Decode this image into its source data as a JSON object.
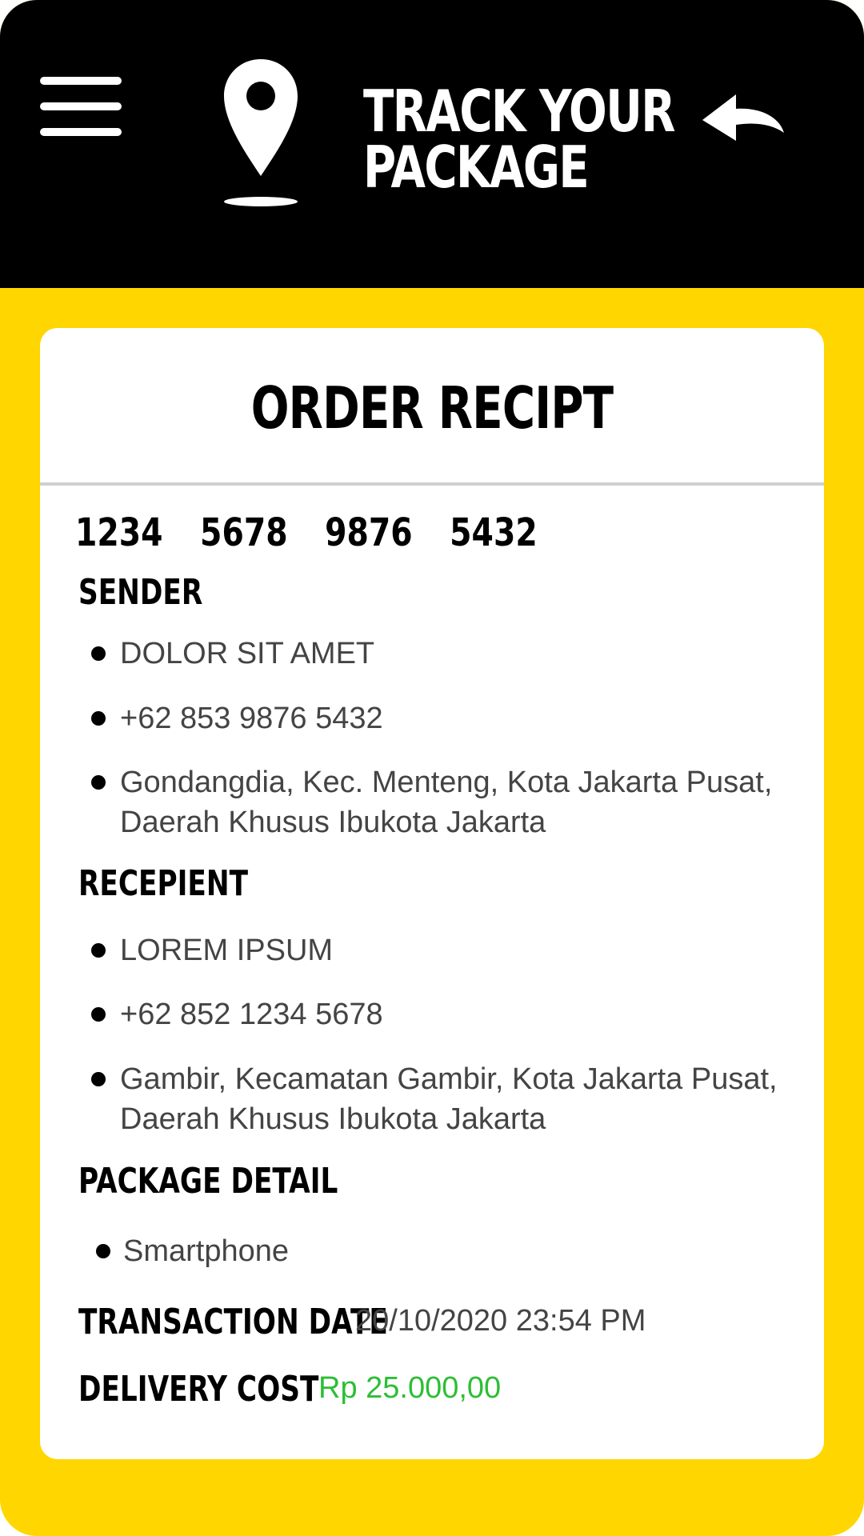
{
  "header": {
    "title_line1": "TRACK YOUR",
    "title_line2": "PACKAGE",
    "menu_icon": "hamburger-menu-icon",
    "pin_icon": "location-pin-icon",
    "back_icon": "back-arrow-icon"
  },
  "receipt": {
    "title": "ORDER RECIPT",
    "tracking_number": [
      "1234",
      "5678",
      "9876",
      "5432"
    ],
    "sender": {
      "label": "SENDER",
      "name": "DOLOR SIT AMET",
      "phone": "+62 853 9876 5432",
      "address_line1": "Gondangdia, Kec. Menteng, Kota Jakarta Pusat,",
      "address_line2": "Daerah Khusus Ibukota Jakarta"
    },
    "recipient": {
      "label": "RECEPIENT",
      "name": "LOREM IPSUM",
      "phone": "+62 852 1234 5678",
      "address_line1": "Gambir, Kecamatan Gambir, Kota Jakarta Pusat,",
      "address_line2": "Daerah Khusus Ibukota Jakarta"
    },
    "package_detail": {
      "label": "PACKAGE DETAIL",
      "item": "Smartphone"
    },
    "transaction_date": {
      "label": "TRANSACTION DATE",
      "value": "20/10/2020 23:54 PM"
    },
    "delivery_cost": {
      "label": "DELIVERY COST",
      "value": "Rp 25.000,00"
    }
  },
  "colors": {
    "background": "#FFD600",
    "header": "#000000",
    "card": "#FFFFFF",
    "cost": "#2DBE35",
    "body_text": "#444444"
  }
}
